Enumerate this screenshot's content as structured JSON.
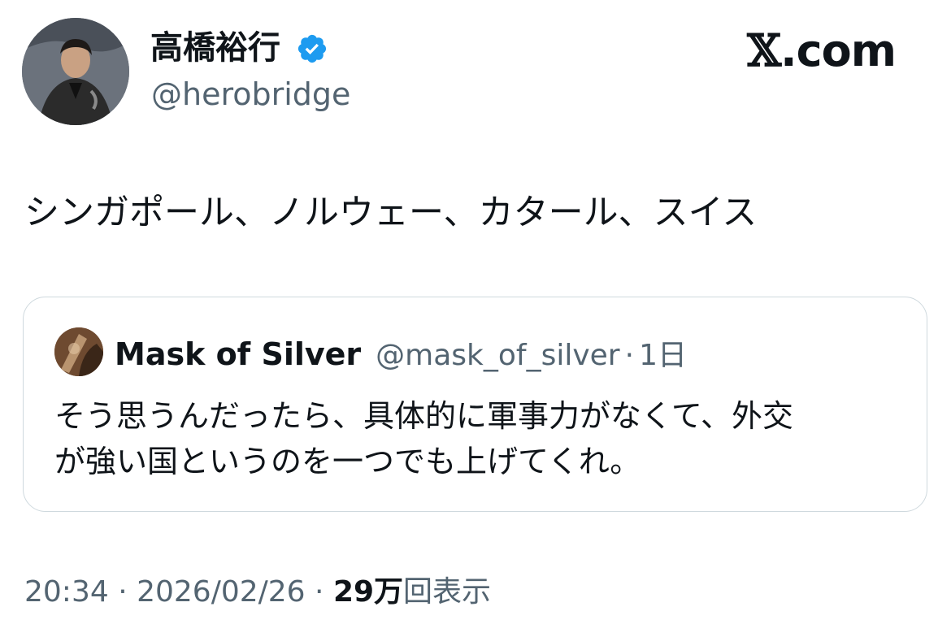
{
  "author": {
    "display_name": "高橋裕行",
    "handle": "@herobridge",
    "verified_icon": "verified-badge-icon",
    "avatar": "profile-photo"
  },
  "brand": {
    "mark": "𝕏",
    "suffix": ".com"
  },
  "tweet": {
    "text": "シンガポール、ノルウェー、カタール、スイス"
  },
  "quoted_tweet": {
    "display_name": "Mask of Silver",
    "handle": "@mask_of_silver",
    "separator": "·",
    "time": "1日",
    "text_lines": [
      "そう思うんだったら、具体的に軍事力がなくて、外交",
      "が強い国というのを一つでも上げてくれ。"
    ]
  },
  "meta": {
    "time": "20:34",
    "sep1": " · ",
    "date": "2026/02/26",
    "sep2": " · ",
    "views_count": "29万",
    "views_label": "回表示"
  },
  "colors": {
    "text_primary": "#0f1419",
    "text_secondary": "#536471",
    "verified_blue": "#1d9bf0",
    "border": "#cfd9de"
  }
}
